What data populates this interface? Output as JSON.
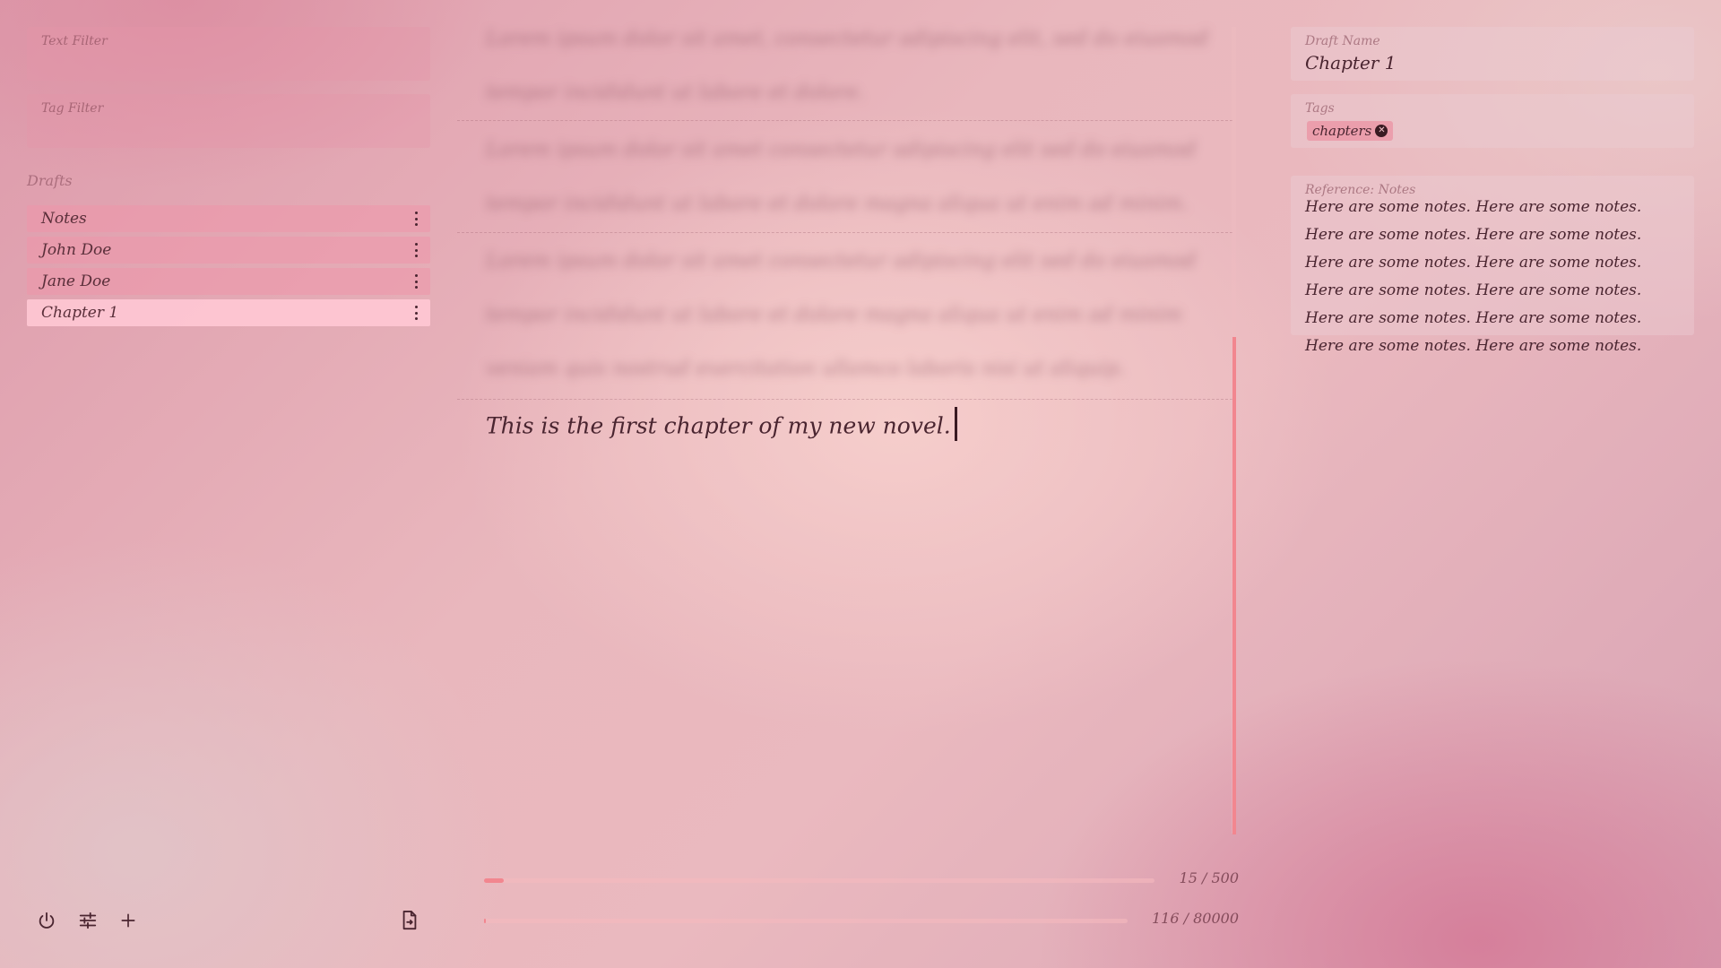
{
  "sidebar": {
    "text_filter_label": "Text Filter",
    "tag_filter_label": "Tag Filter",
    "drafts_heading": "Drafts",
    "drafts": [
      {
        "label": "Notes",
        "selected": false
      },
      {
        "label": "John Doe",
        "selected": false
      },
      {
        "label": "Jane Doe",
        "selected": false
      },
      {
        "label": "Chapter 1",
        "selected": true
      }
    ],
    "footer_icons": [
      "power-icon",
      "sliders-icon",
      "plus-icon",
      "export-file-icon"
    ]
  },
  "editor": {
    "active_paragraph": "This is the first chapter of my new novel.",
    "session_progress": {
      "label": "15 / 500",
      "current": 15,
      "goal": 500
    },
    "total_progress": {
      "label": "116 / 80000",
      "current": 116,
      "goal": 80000
    },
    "accent_color": "#f2868f"
  },
  "right_panel": {
    "draft_name_label": "Draft Name",
    "draft_name": "Chapter 1",
    "tags_label": "Tags",
    "tags": [
      "chapters"
    ],
    "reference_label": "Reference: Notes",
    "reference_text": "Here are some notes. Here are some notes. Here are some notes. Here are some notes. Here are some notes. Here are some notes. Here are some notes. Here are some notes. Here are some notes. Here are some notes. Here are some notes. Here are some notes."
  }
}
